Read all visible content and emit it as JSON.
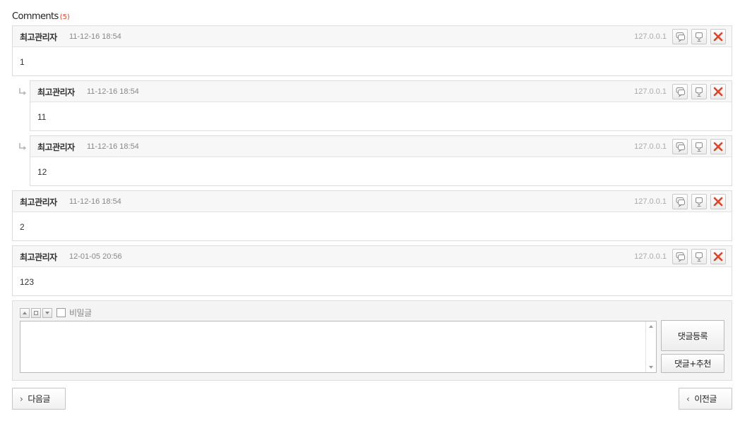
{
  "header": {
    "title": "Comments",
    "count": "(5)"
  },
  "comments": [
    {
      "author": "최고관리자",
      "date": "11-12-16 18:54",
      "ip": "127.0.0.1",
      "body": "1",
      "reply": false
    },
    {
      "author": "최고관리자",
      "date": "11-12-16 18:54",
      "ip": "127.0.0.1",
      "body": "11",
      "reply": true
    },
    {
      "author": "최고관리자",
      "date": "11-12-16 18:54",
      "ip": "127.0.0.1",
      "body": "12",
      "reply": true
    },
    {
      "author": "최고관리자",
      "date": "11-12-16 18:54",
      "ip": "127.0.0.1",
      "body": "2",
      "reply": false
    },
    {
      "author": "최고관리자",
      "date": "12-01-05 20:56",
      "ip": "127.0.0.1",
      "body": "123",
      "reply": false
    }
  ],
  "form": {
    "secret_label": "비밀글",
    "submit_label": "댓글등록",
    "submit_recommend_label": "댓글+추천",
    "textarea_value": ""
  },
  "nav": {
    "next_label": "다음글",
    "prev_label": "이전글"
  },
  "icons": {
    "reply": "reply-icon",
    "recommend": "recommend-icon",
    "delete": "delete-icon",
    "reply_arrow": "reply-arrow-icon"
  },
  "colors": {
    "count": "#e0452a",
    "delete": "#e0452a",
    "head_bg": "#f7f7f7",
    "form_bg": "#f4f4f4"
  }
}
